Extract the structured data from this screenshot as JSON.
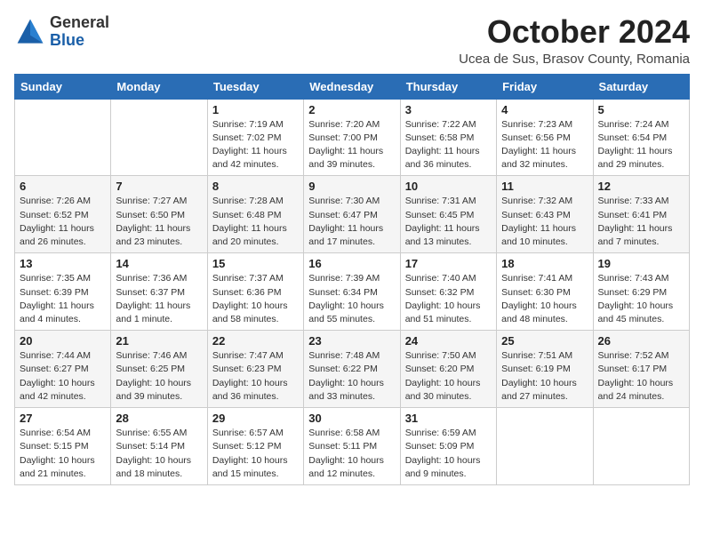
{
  "logo": {
    "general": "General",
    "blue": "Blue"
  },
  "header": {
    "month": "October 2024",
    "location": "Ucea de Sus, Brasov County, Romania"
  },
  "weekdays": [
    "Sunday",
    "Monday",
    "Tuesday",
    "Wednesday",
    "Thursday",
    "Friday",
    "Saturday"
  ],
  "weeks": [
    [
      {
        "day": "",
        "detail": ""
      },
      {
        "day": "",
        "detail": ""
      },
      {
        "day": "1",
        "detail": "Sunrise: 7:19 AM\nSunset: 7:02 PM\nDaylight: 11 hours and 42 minutes."
      },
      {
        "day": "2",
        "detail": "Sunrise: 7:20 AM\nSunset: 7:00 PM\nDaylight: 11 hours and 39 minutes."
      },
      {
        "day": "3",
        "detail": "Sunrise: 7:22 AM\nSunset: 6:58 PM\nDaylight: 11 hours and 36 minutes."
      },
      {
        "day": "4",
        "detail": "Sunrise: 7:23 AM\nSunset: 6:56 PM\nDaylight: 11 hours and 32 minutes."
      },
      {
        "day": "5",
        "detail": "Sunrise: 7:24 AM\nSunset: 6:54 PM\nDaylight: 11 hours and 29 minutes."
      }
    ],
    [
      {
        "day": "6",
        "detail": "Sunrise: 7:26 AM\nSunset: 6:52 PM\nDaylight: 11 hours and 26 minutes."
      },
      {
        "day": "7",
        "detail": "Sunrise: 7:27 AM\nSunset: 6:50 PM\nDaylight: 11 hours and 23 minutes."
      },
      {
        "day": "8",
        "detail": "Sunrise: 7:28 AM\nSunset: 6:48 PM\nDaylight: 11 hours and 20 minutes."
      },
      {
        "day": "9",
        "detail": "Sunrise: 7:30 AM\nSunset: 6:47 PM\nDaylight: 11 hours and 17 minutes."
      },
      {
        "day": "10",
        "detail": "Sunrise: 7:31 AM\nSunset: 6:45 PM\nDaylight: 11 hours and 13 minutes."
      },
      {
        "day": "11",
        "detail": "Sunrise: 7:32 AM\nSunset: 6:43 PM\nDaylight: 11 hours and 10 minutes."
      },
      {
        "day": "12",
        "detail": "Sunrise: 7:33 AM\nSunset: 6:41 PM\nDaylight: 11 hours and 7 minutes."
      }
    ],
    [
      {
        "day": "13",
        "detail": "Sunrise: 7:35 AM\nSunset: 6:39 PM\nDaylight: 11 hours and 4 minutes."
      },
      {
        "day": "14",
        "detail": "Sunrise: 7:36 AM\nSunset: 6:37 PM\nDaylight: 11 hours and 1 minute."
      },
      {
        "day": "15",
        "detail": "Sunrise: 7:37 AM\nSunset: 6:36 PM\nDaylight: 10 hours and 58 minutes."
      },
      {
        "day": "16",
        "detail": "Sunrise: 7:39 AM\nSunset: 6:34 PM\nDaylight: 10 hours and 55 minutes."
      },
      {
        "day": "17",
        "detail": "Sunrise: 7:40 AM\nSunset: 6:32 PM\nDaylight: 10 hours and 51 minutes."
      },
      {
        "day": "18",
        "detail": "Sunrise: 7:41 AM\nSunset: 6:30 PM\nDaylight: 10 hours and 48 minutes."
      },
      {
        "day": "19",
        "detail": "Sunrise: 7:43 AM\nSunset: 6:29 PM\nDaylight: 10 hours and 45 minutes."
      }
    ],
    [
      {
        "day": "20",
        "detail": "Sunrise: 7:44 AM\nSunset: 6:27 PM\nDaylight: 10 hours and 42 minutes."
      },
      {
        "day": "21",
        "detail": "Sunrise: 7:46 AM\nSunset: 6:25 PM\nDaylight: 10 hours and 39 minutes."
      },
      {
        "day": "22",
        "detail": "Sunrise: 7:47 AM\nSunset: 6:23 PM\nDaylight: 10 hours and 36 minutes."
      },
      {
        "day": "23",
        "detail": "Sunrise: 7:48 AM\nSunset: 6:22 PM\nDaylight: 10 hours and 33 minutes."
      },
      {
        "day": "24",
        "detail": "Sunrise: 7:50 AM\nSunset: 6:20 PM\nDaylight: 10 hours and 30 minutes."
      },
      {
        "day": "25",
        "detail": "Sunrise: 7:51 AM\nSunset: 6:19 PM\nDaylight: 10 hours and 27 minutes."
      },
      {
        "day": "26",
        "detail": "Sunrise: 7:52 AM\nSunset: 6:17 PM\nDaylight: 10 hours and 24 minutes."
      }
    ],
    [
      {
        "day": "27",
        "detail": "Sunrise: 6:54 AM\nSunset: 5:15 PM\nDaylight: 10 hours and 21 minutes."
      },
      {
        "day": "28",
        "detail": "Sunrise: 6:55 AM\nSunset: 5:14 PM\nDaylight: 10 hours and 18 minutes."
      },
      {
        "day": "29",
        "detail": "Sunrise: 6:57 AM\nSunset: 5:12 PM\nDaylight: 10 hours and 15 minutes."
      },
      {
        "day": "30",
        "detail": "Sunrise: 6:58 AM\nSunset: 5:11 PM\nDaylight: 10 hours and 12 minutes."
      },
      {
        "day": "31",
        "detail": "Sunrise: 6:59 AM\nSunset: 5:09 PM\nDaylight: 10 hours and 9 minutes."
      },
      {
        "day": "",
        "detail": ""
      },
      {
        "day": "",
        "detail": ""
      }
    ]
  ]
}
